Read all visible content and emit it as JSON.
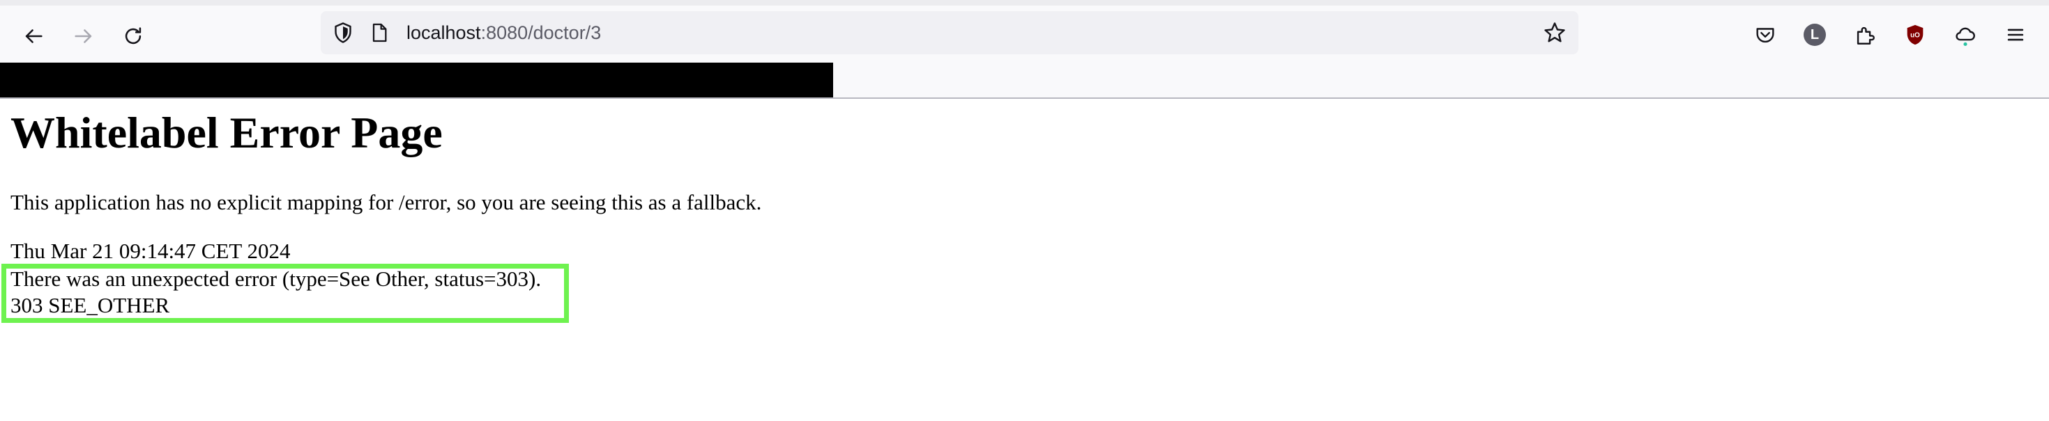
{
  "browser": {
    "url_host": "localhost",
    "url_rest": ":8080/doctor/3",
    "profile_initial": "L",
    "icons": {
      "back": "back-arrow-icon",
      "forward": "forward-arrow-icon",
      "reload": "reload-icon",
      "site_info": "shield-icon",
      "page": "page-icon",
      "bookmark": "star-icon",
      "pocket": "pocket-icon",
      "extensions": "puzzle-icon",
      "ublock": "ublock-icon",
      "sync": "cloud-icon",
      "menu": "hamburger-menu-icon"
    },
    "colors": {
      "ublock": "#800000",
      "sync_dot": "#2ac3a2"
    }
  },
  "page": {
    "title": "Whitelabel Error Page",
    "description": "This application has no explicit mapping for /error, so you are seeing this as a fallback.",
    "timestamp": "Thu Mar 21 09:14:47 CET 2024",
    "error_message": "There was an unexpected error (type=See Other, status=303).",
    "status_line": "303 SEE_OTHER",
    "highlight_color": "#6ef24f"
  }
}
